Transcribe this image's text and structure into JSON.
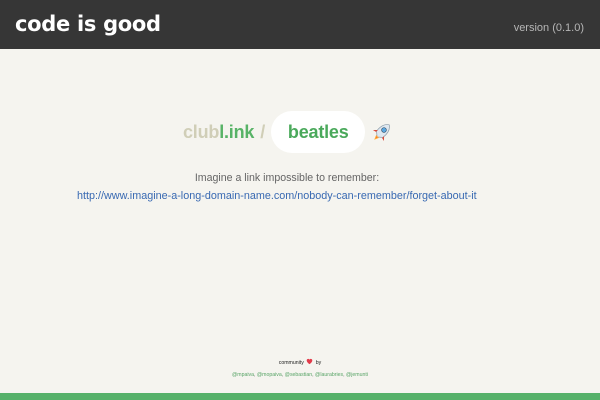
{
  "header": {
    "title": "code is good",
    "version": "version (0.1.0)"
  },
  "shortener": {
    "domain_prefix": "club",
    "domain_accent": "l.ink",
    "separator": "/",
    "slug": "beatles",
    "icon": "rocket-icon"
  },
  "intro": {
    "text": "Imagine a link impossible to remember:",
    "example_url": "http://www.imagine-a-long-domain-name.com/nobody-can-remember/forget-about-it"
  },
  "footer": {
    "community_prefix": "community",
    "by_text": "by",
    "heart_icon": "heart-icon",
    "contributors": [
      "@mpaiva",
      "@mopaiva",
      "@sebastian",
      "@laurabries",
      "@jemunti"
    ]
  },
  "colors": {
    "header_bg": "#363636",
    "page_bg": "#f5f4ef",
    "accent_green": "#56b16a",
    "link_blue": "#3869b2",
    "heart_red": "#e23b4a"
  }
}
